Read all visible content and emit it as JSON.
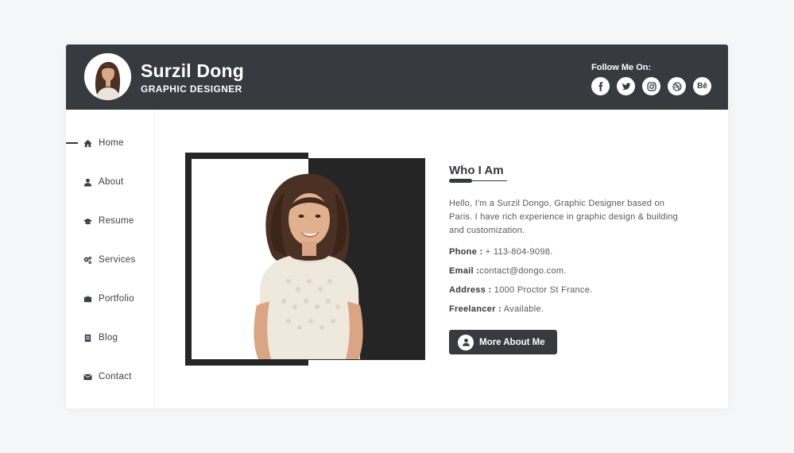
{
  "header": {
    "name": "Surzil Dong",
    "role": "GRAPHIC DESIGNER",
    "follow_label": "Follow Me On:",
    "socials": [
      {
        "icon": "facebook-icon"
      },
      {
        "icon": "twitter-icon"
      },
      {
        "icon": "instagram-icon"
      },
      {
        "icon": "dribbble-icon"
      },
      {
        "icon": "behance-icon",
        "label": "Bē"
      }
    ]
  },
  "sidebar": {
    "items": [
      {
        "label": "Home",
        "icon": "home-icon",
        "active": true
      },
      {
        "label": "About",
        "icon": "user-icon"
      },
      {
        "label": "Resume",
        "icon": "graduation-cap-icon"
      },
      {
        "label": "Services",
        "icon": "cogs-icon"
      },
      {
        "label": "Portfolio",
        "icon": "briefcase-icon"
      },
      {
        "label": "Blog",
        "icon": "book-icon"
      },
      {
        "label": "Contact",
        "icon": "envelope-icon"
      }
    ]
  },
  "about": {
    "title": "Who I Am",
    "bio": "Hello, I'm a Surzil Dongo, Graphic Designer based on Paris. I have rich experience in graphic design & building and customization.",
    "phone_label": "Phone :",
    "phone": " + 113-804-9098.",
    "email_label": "Email :",
    "email": "contact@dongo.com.",
    "address_label": "Address :",
    "address": " 1000 Proctor St France.",
    "freelancer_label": "Freelancer :",
    "freelancer": " Available.",
    "button_label": "More About Me"
  },
  "colors": {
    "header_bg": "#373a3f",
    "page_bg": "#f5f6f8",
    "photo_bg": "#252525"
  }
}
